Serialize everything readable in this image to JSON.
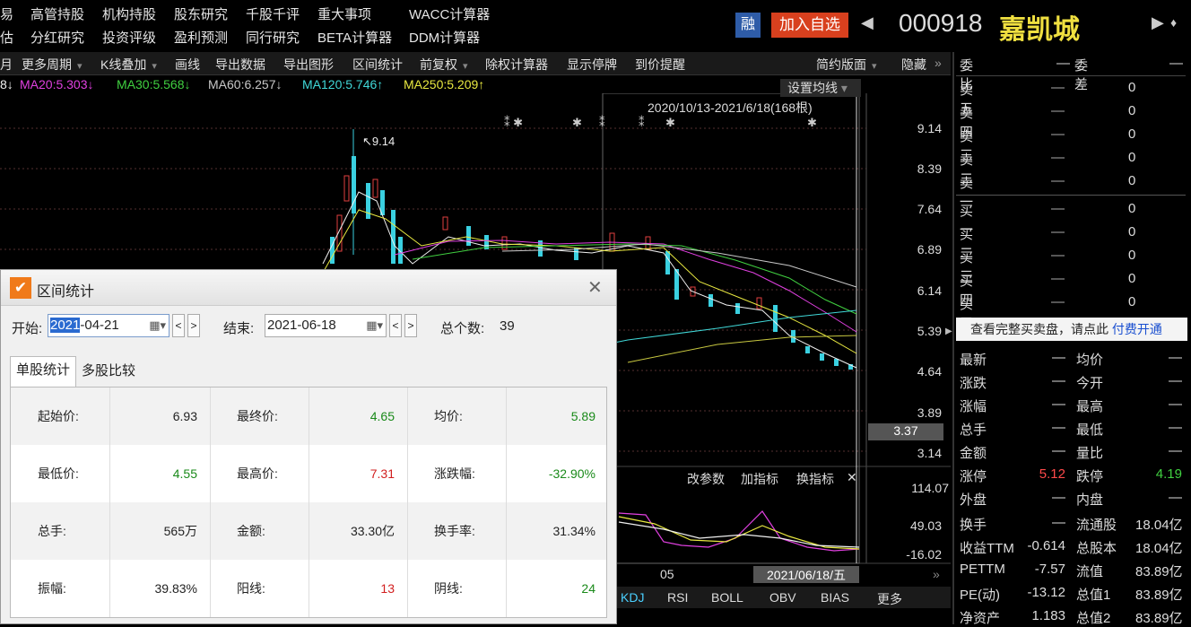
{
  "menu_row1": [
    "易",
    "高管持股",
    "机构持股",
    "股东研究",
    "千股千评",
    "重大事项",
    "WACC计算器"
  ],
  "menu_row2": [
    "估",
    "分红研究",
    "投资评级",
    "盈利预测",
    "同行研究",
    "BETA计算器",
    "DDM计算器"
  ],
  "header": {
    "rong": "融",
    "add_watch": "加入自选",
    "code": "000918",
    "name": "嘉凯城"
  },
  "toolbar": [
    "月",
    "更多周期",
    "K线叠加",
    "画线",
    "导出数据",
    "导出图形",
    "区间统计",
    "前复权",
    "除权计算器",
    "显示停牌",
    "到价提醒",
    "简约版面",
    "隐藏"
  ],
  "ma_labels": [
    {
      "text": "8↓",
      "color": "#f0f0f0"
    },
    {
      "text": "MA20:5.303↓",
      "color": "#e040e0"
    },
    {
      "text": "MA30:5.568↓",
      "color": "#40d040"
    },
    {
      "text": "MA60:6.257↓",
      "color": "#c8c8c8"
    },
    {
      "text": "MA120:5.746↑",
      "color": "#40d8d8"
    },
    {
      "text": "MA250:5.209↑",
      "color": "#e8e840"
    }
  ],
  "chart": {
    "set_ma": "设置均线",
    "range_label": "2020/10/13-2021/6/18(168根)",
    "peak_label": "9.14",
    "y_ticks": [
      "9.14",
      "8.39",
      "7.64",
      "6.89",
      "6.14",
      "5.39",
      "4.64",
      "3.89",
      "3.14"
    ],
    "cursor_price": "3.37",
    "indicator_buttons": [
      "改参数",
      "加指标",
      "换指标"
    ],
    "ind_ticks": [
      "114.07",
      "49.03",
      "-16.02"
    ],
    "x_label": "05",
    "date_box": "2021/06/18/五",
    "bottom_tabs": [
      "KDJ",
      "RSI",
      "BOLL",
      "OBV",
      "BIAS",
      "更多"
    ]
  },
  "orderbook": {
    "header": [
      "委比",
      "—",
      "委差",
      "—"
    ],
    "asks": [
      {
        "n": "卖五",
        "d": "—",
        "v": "0"
      },
      {
        "n": "卖四",
        "d": "—",
        "v": "0"
      },
      {
        "n": "卖三",
        "d": "—",
        "v": "0"
      },
      {
        "n": "卖二",
        "d": "—",
        "v": "0"
      },
      {
        "n": "卖一",
        "d": "—",
        "v": "0"
      }
    ],
    "bids": [
      {
        "n": "买一",
        "d": "—",
        "v": "0"
      },
      {
        "n": "买二",
        "d": "—",
        "v": "0"
      },
      {
        "n": "买三",
        "d": "—",
        "v": "0"
      },
      {
        "n": "买四",
        "d": "—",
        "v": "0"
      },
      {
        "n": "买五",
        "d": "—",
        "v": "0"
      }
    ],
    "promo_text": "查看完整买卖盘，请点此",
    "promo_link": "付费开通"
  },
  "stats": [
    {
      "l1": "最新",
      "v1": "—",
      "l2": "均价",
      "v2": "—"
    },
    {
      "l1": "涨跌",
      "v1": "—",
      "l2": "今开",
      "v2": "—"
    },
    {
      "l1": "涨幅",
      "v1": "—",
      "l2": "最高",
      "v2": "—"
    },
    {
      "l1": "总手",
      "v1": "—",
      "l2": "最低",
      "v2": "—"
    },
    {
      "l1": "金额",
      "v1": "—",
      "l2": "量比",
      "v2": "—"
    },
    {
      "l1": "涨停",
      "v1": "5.12",
      "l2": "跌停",
      "v2": "4.19"
    },
    {
      "l1": "外盘",
      "v1": "—",
      "l2": "内盘",
      "v2": "—"
    },
    {
      "l1": "换手",
      "v1": "—",
      "l2": "流通股",
      "v2": "18.04亿"
    },
    {
      "l1": "收益TTM",
      "v1": "-0.614",
      "l2": "总股本",
      "v2": "18.04亿"
    },
    {
      "l1": "PETTM",
      "v1": "-7.57",
      "l2": "流值",
      "v2": "83.89亿"
    },
    {
      "l1": "PE(动)",
      "v1": "-13.12",
      "l2": "总值1",
      "v2": "83.89亿"
    },
    {
      "l1": "净资产",
      "v1": "1.183",
      "l2": "总值2",
      "v2": "83.89亿"
    }
  ],
  "dialog": {
    "title": "区间统计",
    "start_label": "开始:",
    "start_year": "2021",
    "start_rest": "-04-21",
    "end_label": "结束:",
    "end_value": "2021-06-18",
    "count_label": "总个数:",
    "count": "39",
    "tabs": [
      "单股统计",
      "多股比较"
    ],
    "rows": [
      [
        {
          "l": "起始价:",
          "v": "6.93",
          "c": ""
        },
        {
          "l": "最终价:",
          "v": "4.65",
          "c": "green"
        },
        {
          "l": "均价:",
          "v": "5.89",
          "c": "green"
        }
      ],
      [
        {
          "l": "最低价:",
          "v": "4.55",
          "c": "green"
        },
        {
          "l": "最高价:",
          "v": "7.31",
          "c": "red"
        },
        {
          "l": "涨跌幅:",
          "v": "-32.90%",
          "c": "green"
        }
      ],
      [
        {
          "l": "总手:",
          "v": "565万",
          "c": ""
        },
        {
          "l": "金额:",
          "v": "33.30亿",
          "c": ""
        },
        {
          "l": "换手率:",
          "v": "31.34%",
          "c": ""
        }
      ],
      [
        {
          "l": "振幅:",
          "v": "39.83%",
          "c": ""
        },
        {
          "l": "阳线:",
          "v": "13",
          "c": "red"
        },
        {
          "l": "阴线:",
          "v": "24",
          "c": "green"
        }
      ]
    ]
  }
}
